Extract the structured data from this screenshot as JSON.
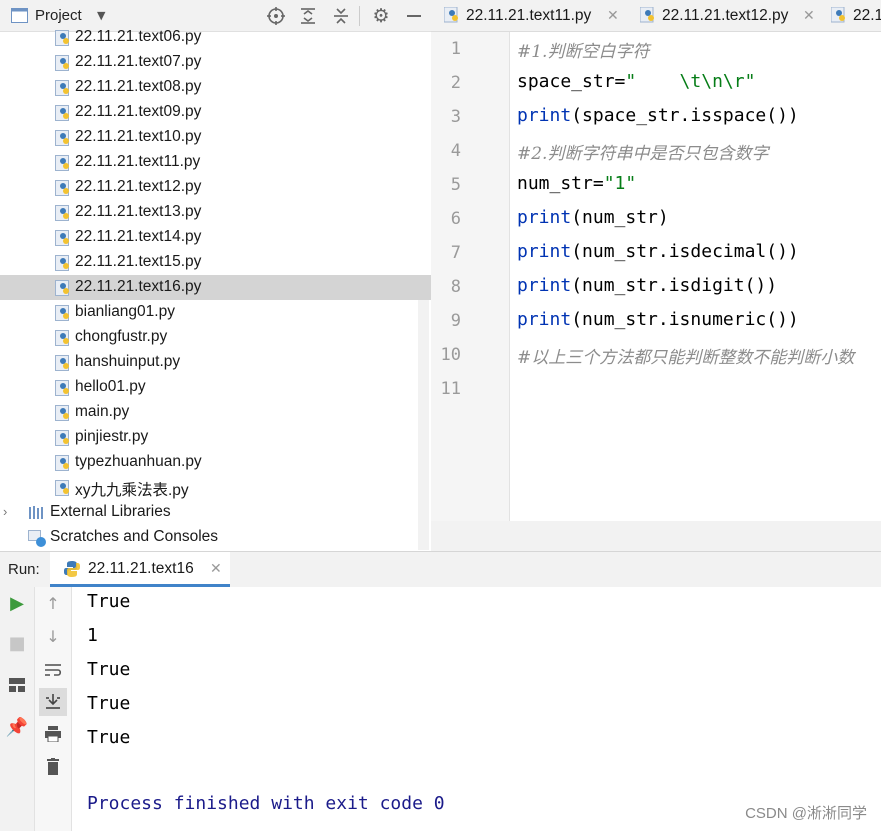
{
  "project": {
    "title": "Project",
    "files": [
      "22.11.21.text06.py",
      "22.11.21.text07.py",
      "22.11.21.text08.py",
      "22.11.21.text09.py",
      "22.11.21.text10.py",
      "22.11.21.text11.py",
      "22.11.21.text12.py",
      "22.11.21.text13.py",
      "22.11.21.text14.py",
      "22.11.21.text15.py",
      "22.11.21.text16.py",
      "bianliang01.py",
      "chongfustr.py",
      "hanshuinput.py",
      "hello01.py",
      "main.py",
      "pinjiestr.py",
      "typezhuanhuan.py",
      "xy九九乘法表.py"
    ],
    "selected_file": "22.11.21.text16.py",
    "external_libraries": "External Libraries",
    "scratches": "Scratches and Consoles"
  },
  "editor": {
    "tabs": [
      "22.11.21.text11.py",
      "22.11.21.text12.py",
      "22.1"
    ],
    "line_numbers": [
      "1",
      "2",
      "3",
      "4",
      "5",
      "6",
      "7",
      "8",
      "9",
      "10",
      "11"
    ],
    "lines": {
      "l1": "#1.判断空白字符",
      "l2_a": "space_str=",
      "l2_b": "\"    \\t\\n\\r\"",
      "l3_a": "print",
      "l3_b": "(space_str.isspace())",
      "l4": "#2.判断字符串中是否只包含数字",
      "l5_a": "num_str=",
      "l5_b": "\"1\"",
      "l6_a": "print",
      "l6_b": "(num_str)",
      "l7_a": "print",
      "l7_b": "(num_str.isdecimal())",
      "l8_a": "print",
      "l8_b": "(num_str.isdigit())",
      "l9_a": "print",
      "l9_b": "(num_str.isnumeric())",
      "l10": "#以上三个方法都只能判断整数不能判断小数",
      "l11": ""
    }
  },
  "run": {
    "label": "Run:",
    "tab": "22.11.21.text16",
    "output": [
      "True",
      "1",
      "True",
      "True",
      "True"
    ],
    "process": "Process finished with exit code 0"
  },
  "watermark": "CSDN @淅淅同学",
  "colors": {
    "keyword": "#0033b3",
    "string": "#067d17",
    "comment": "#8c8c8c",
    "selection": "#d4d4d4",
    "run_accent": "#4083c9"
  }
}
